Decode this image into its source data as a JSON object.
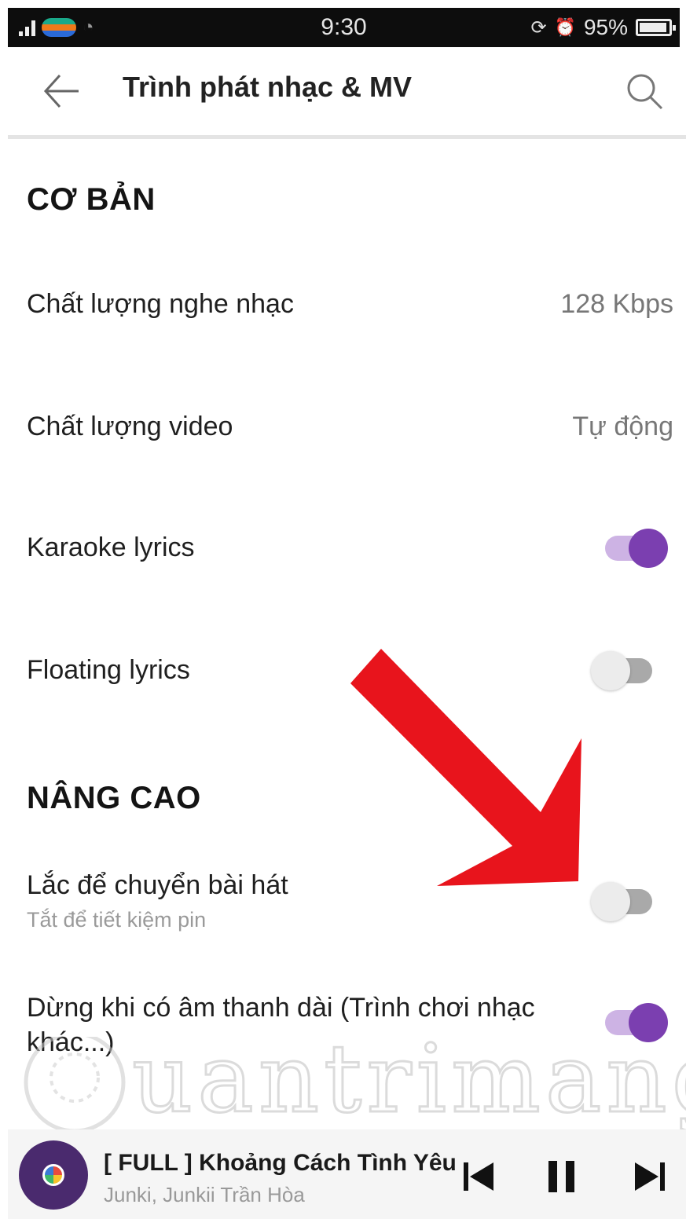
{
  "status_bar": {
    "time": "9:30",
    "battery": "95%"
  },
  "app_bar": {
    "title": "Trình phát nhạc & MV",
    "back_icon": "arrow-left-icon",
    "search_icon": "search-icon"
  },
  "sections": {
    "basic": {
      "title": "CƠ BẢN",
      "items": [
        {
          "label": "Chất lượng nghe nhạc",
          "value": "128 Kbps"
        },
        {
          "label": "Chất lượng video",
          "value": "Tự động"
        },
        {
          "label": "Karaoke lyrics",
          "toggle": true
        },
        {
          "label": "Floating lyrics",
          "toggle": false
        }
      ]
    },
    "advanced": {
      "title": "NÂNG CAO",
      "items": [
        {
          "label": "Lắc để chuyển bài hát",
          "sub": "Tắt để tiết kiệm pin",
          "toggle": false
        },
        {
          "label": "Dừng khi có âm thanh dài (Trình chơi nhạc",
          "label_line2": "khác...)",
          "toggle": true
        }
      ]
    }
  },
  "watermark": "Quantrimang",
  "player": {
    "song": "[ FULL ] Khoảng Cách Tình Yêu",
    "artist": "Junki, Junkii Trần Hòa",
    "icons": [
      "skip-previous-icon",
      "pause-icon",
      "skip-next-icon"
    ]
  },
  "colors": {
    "accent": "#7b3fb0",
    "accent_light": "#cdb3e4",
    "arrow": "#e8141c"
  }
}
